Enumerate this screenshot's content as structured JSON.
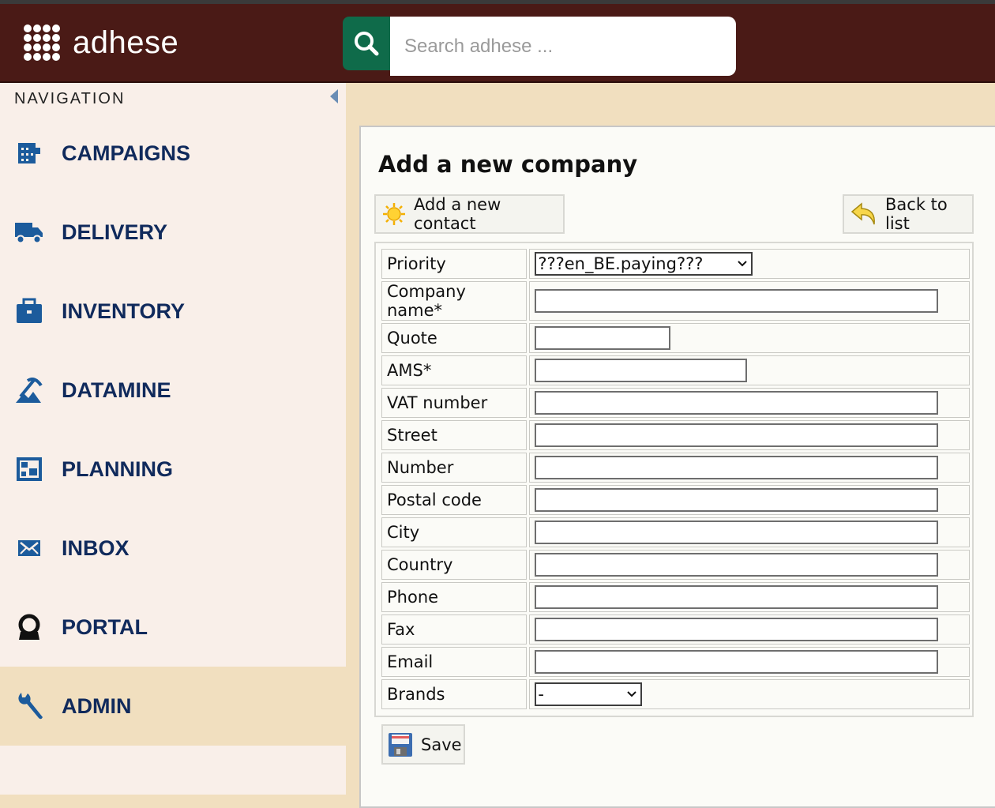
{
  "header": {
    "logo_text": "adhese",
    "search": {
      "placeholder": "Search adhese ..."
    },
    "icons": {
      "logo": "adhese-dots-logo",
      "search": "search-icon"
    },
    "colors": {
      "header_bg": "#4a1a16",
      "search_button": "#0f6b4a"
    }
  },
  "sidebar": {
    "title": "NAVIGATION",
    "items": [
      {
        "label": "CAMPAIGNS",
        "icon": "campaigns-icon",
        "active": false
      },
      {
        "label": "DELIVERY",
        "icon": "truck-icon",
        "active": false
      },
      {
        "label": "INVENTORY",
        "icon": "briefcase-icon",
        "active": false
      },
      {
        "label": "DATAMINE",
        "icon": "pickaxe-icon",
        "active": false
      },
      {
        "label": "PLANNING",
        "icon": "planning-board-icon",
        "active": false
      },
      {
        "label": "INBOX",
        "icon": "envelope-icon",
        "active": false
      },
      {
        "label": "PORTAL",
        "icon": "portal-icon",
        "active": false
      },
      {
        "label": "ADMIN",
        "icon": "wrench-icon",
        "active": true
      }
    ]
  },
  "main": {
    "title": "Add a new company",
    "add_contact_label": "Add a new contact",
    "back_label": "Back to list",
    "save_label": "Save",
    "fields": {
      "priority": {
        "label": "Priority",
        "value": "???en_BE.paying???"
      },
      "company_name": {
        "label": "Company name*",
        "value": ""
      },
      "quote": {
        "label": "Quote",
        "value": ""
      },
      "ams": {
        "label": "AMS*",
        "value": ""
      },
      "vat_number": {
        "label": "VAT number",
        "value": ""
      },
      "street": {
        "label": "Street",
        "value": ""
      },
      "number": {
        "label": "Number",
        "value": ""
      },
      "postal_code": {
        "label": "Postal code",
        "value": ""
      },
      "city": {
        "label": "City",
        "value": ""
      },
      "country": {
        "label": "Country",
        "value": ""
      },
      "phone": {
        "label": "Phone",
        "value": ""
      },
      "fax": {
        "label": "Fax",
        "value": ""
      },
      "email": {
        "label": "Email",
        "value": ""
      },
      "brands": {
        "label": "Brands",
        "value": "-"
      }
    }
  }
}
